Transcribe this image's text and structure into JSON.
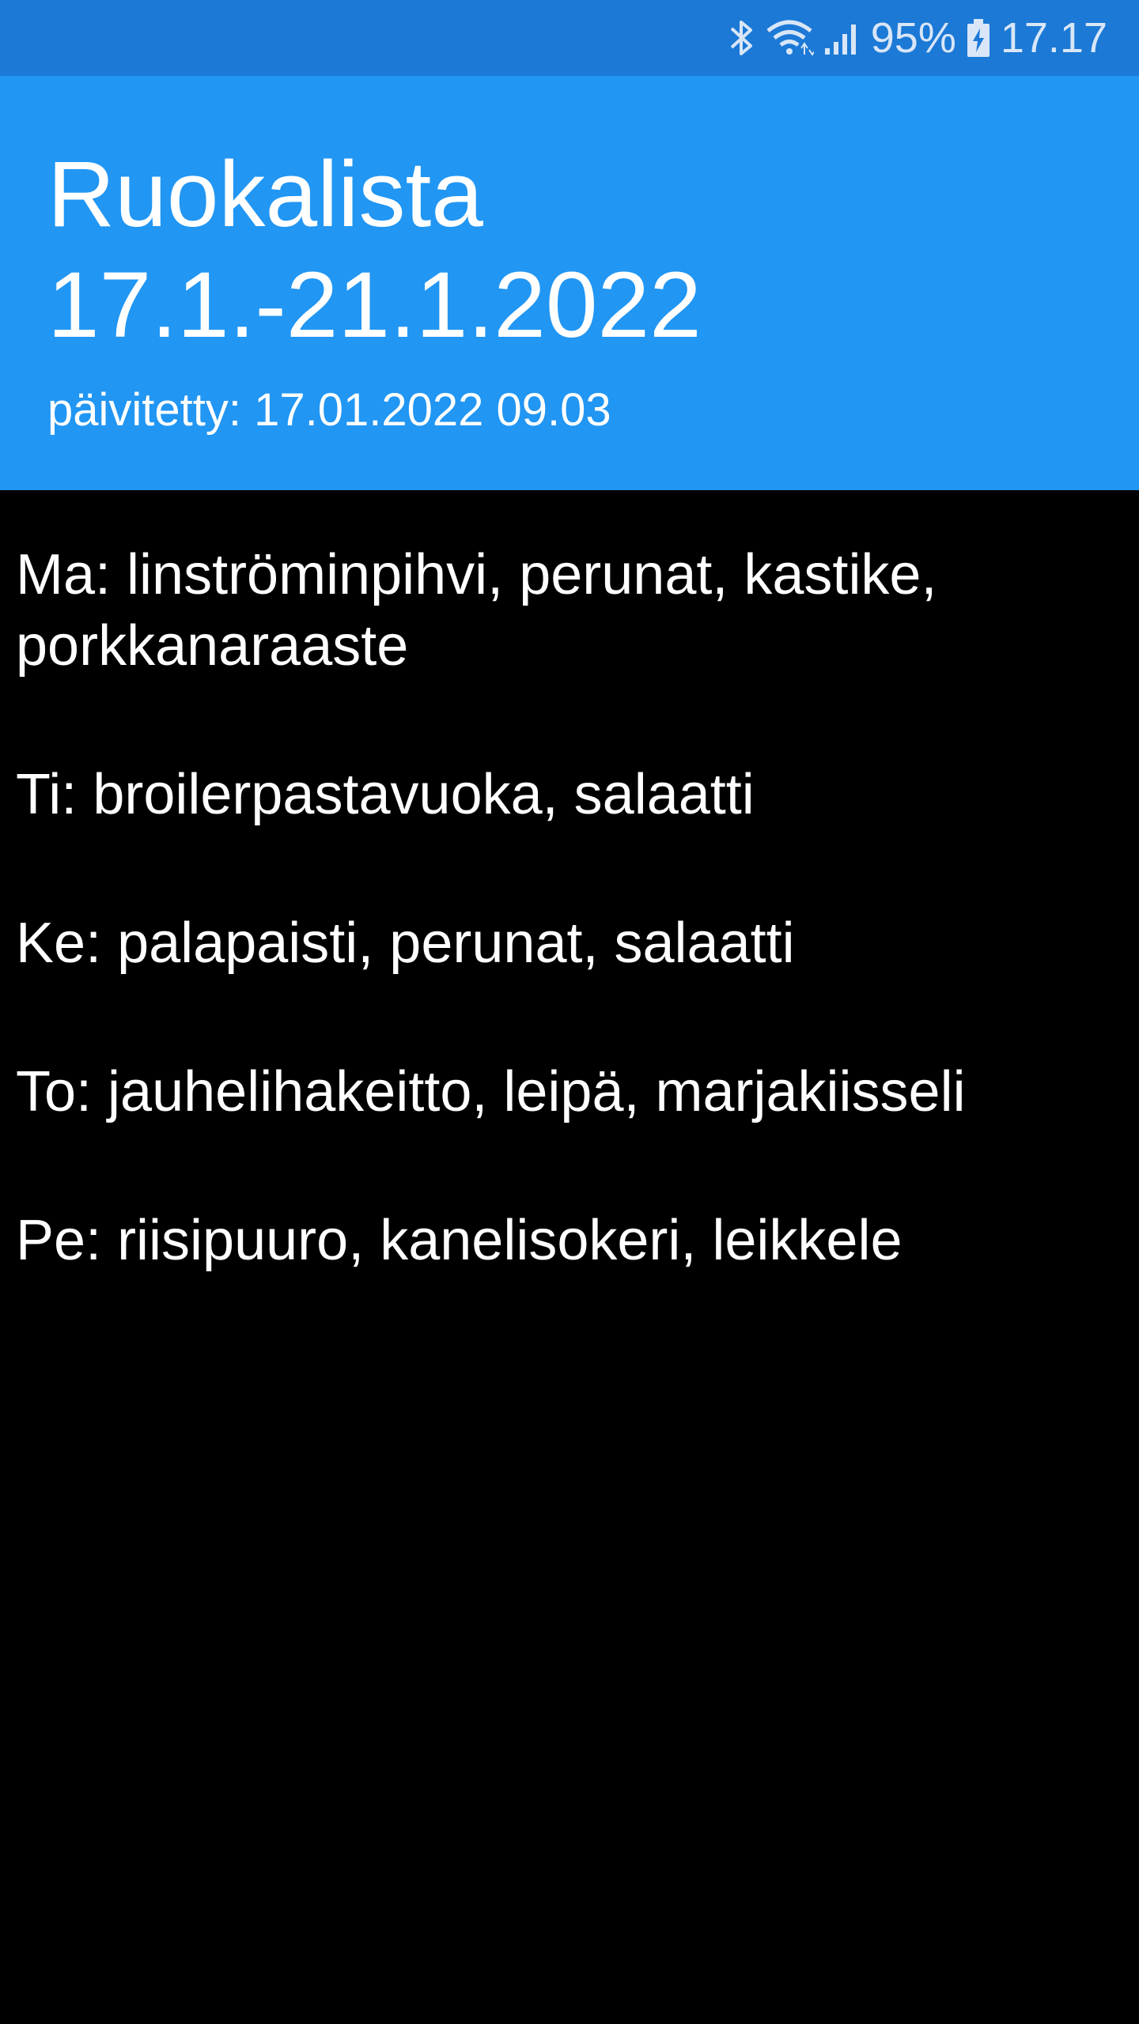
{
  "status_bar": {
    "battery_percent": "95%",
    "time": "17.17",
    "icons": [
      "bluetooth-icon",
      "wifi-icon",
      "signal-icon",
      "battery-charging-icon"
    ],
    "background_color": "#1c79d6"
  },
  "header": {
    "title_line1": "Ruokalista",
    "title_line2": "17.1.-21.1.2022",
    "updated": "päivitetty: 17.01.2022 09.03",
    "background_color": "#2196f3"
  },
  "menu": {
    "items": [
      "Ma: linströminpihvi, perunat, kastike, porkkanaraaste",
      "Ti: broilerpastavuoka, salaatti",
      "Ke: palapaisti, perunat, salaatti",
      "To: jauhelihakeitto, leipä, marjakiisseli",
      "Pe: riisipuuro, kanelisokeri, leikkele"
    ],
    "background_color": "#000000"
  }
}
